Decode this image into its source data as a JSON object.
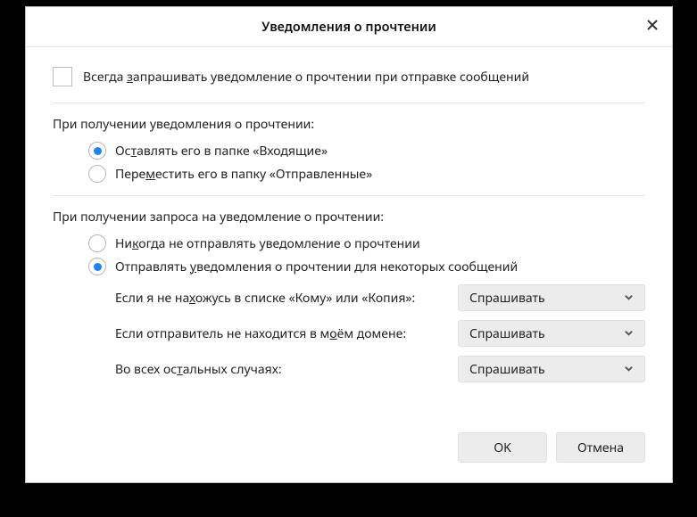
{
  "title": "Уведомления о прочтении",
  "always_request": {
    "checked": false,
    "label_parts": [
      "Всегда ",
      "з",
      "апрашивать уведомление о прочтении при отправке сообщений"
    ]
  },
  "receipt_received": {
    "label": "При получении уведомления о прочтении:",
    "options": [
      {
        "checked": true,
        "parts": [
          "Ос",
          "т",
          "авлять его в папке «Входящие»"
        ]
      },
      {
        "checked": false,
        "parts": [
          "Пере",
          "м",
          "естить его в папку «Отправленные»"
        ]
      }
    ]
  },
  "receipt_request": {
    "label": "При получении запроса на уведомление о прочтении:",
    "options": [
      {
        "checked": false,
        "parts": [
          "Ни",
          "к",
          "огда не отправлять уведомление о прочтении"
        ]
      },
      {
        "checked": true,
        "parts": [
          "Отправлять ",
          "у",
          "ведомления о прочтении для некоторых сообщений"
        ]
      }
    ]
  },
  "conditions": [
    {
      "parts": [
        "Если я не на",
        "х",
        "ожусь в списке «Кому» или «Копия»:"
      ],
      "value": "Спрашивать"
    },
    {
      "parts": [
        "Если отправитель не находится в м",
        "о",
        "ём домене:"
      ],
      "value": "Спрашивать"
    },
    {
      "parts": [
        "Во всех ос",
        "т",
        "альных случаях:"
      ],
      "value": "Спрашивать"
    }
  ],
  "buttons": {
    "ok": "OK",
    "cancel": "Отмена"
  }
}
